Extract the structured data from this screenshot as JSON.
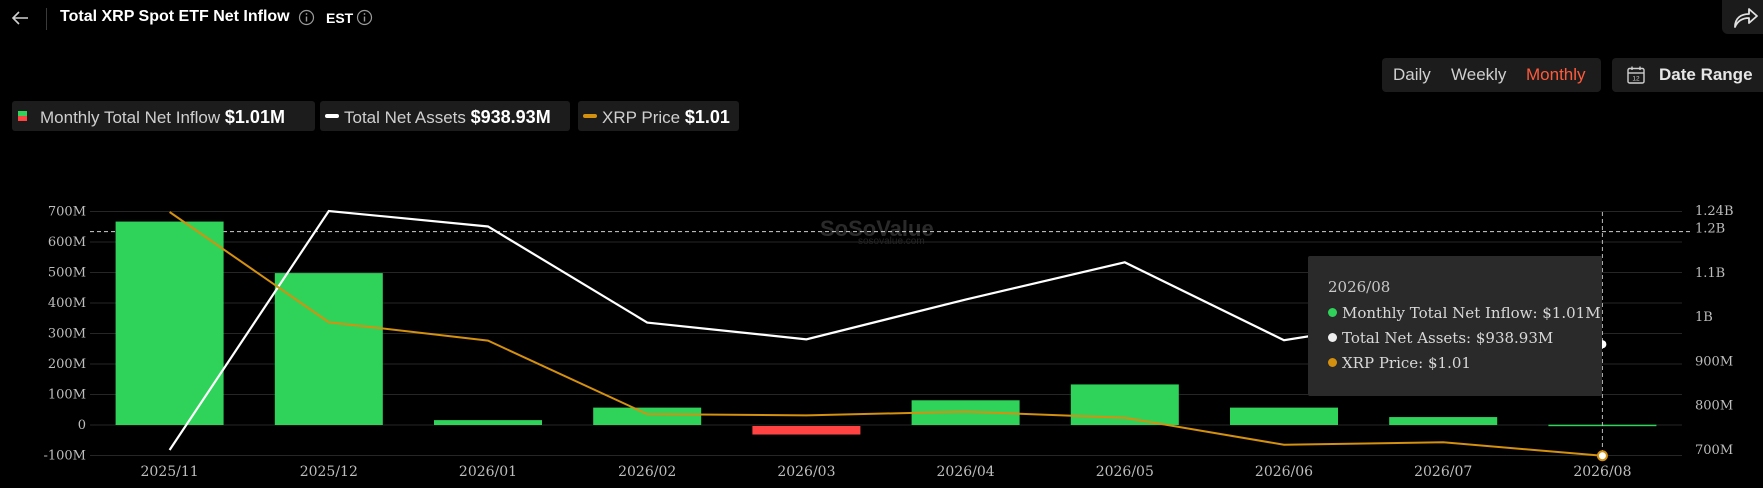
{
  "header": {
    "title": "Total XRP Spot ETF Net Inflow",
    "timezone": "EST"
  },
  "period_tabs": [
    {
      "label": "Daily",
      "active": false
    },
    {
      "label": "Weekly",
      "active": false
    },
    {
      "label": "Monthly",
      "active": true
    }
  ],
  "date_range_label": "Date Range",
  "legend": {
    "inflow_label": "Monthly Total Net Inflow",
    "inflow_value": "$1.01M",
    "assets_label": "Total Net Assets",
    "assets_value": "$938.93M",
    "price_label": "XRP Price",
    "price_value": "$1.01"
  },
  "watermark": {
    "name": "SoSoValue",
    "url": "sosovalue.com"
  },
  "tooltip": {
    "date": "2026/08",
    "inflow": "Monthly Total Net Inflow: $1.01M",
    "assets": "Total Net Assets: $938.93M",
    "price": "XRP Price: $1.01"
  },
  "colors": {
    "positive_bar": "#2fd35a",
    "negative_bar": "#ff4343",
    "assets_line": "#ffffff",
    "price_line": "#d4900f",
    "accent": "#ff5a3c"
  },
  "chart_data": {
    "type": "bar",
    "categories": [
      "2025/11",
      "2025/12",
      "2026/01",
      "2026/02",
      "2026/03",
      "2026/04",
      "2026/05",
      "2026/06",
      "2026/07",
      "2026/08"
    ],
    "y_left_ticks": [
      "700M",
      "600M",
      "500M",
      "400M",
      "300M",
      "200M",
      "100M",
      "0",
      "-100M"
    ],
    "y_right_ticks": [
      "1.24B",
      "1.2B",
      "1.1B",
      "1B",
      "900M",
      "800M",
      "700M"
    ],
    "left_axis_range": [
      -100,
      700
    ],
    "right_axis_range": [
      700,
      1240
    ],
    "series": [
      {
        "name": "Monthly Total Net Inflow",
        "axis": "left",
        "unit": "M",
        "values": [
          667,
          498,
          16,
          57,
          -28,
          81,
          133,
          57,
          26,
          1.01
        ]
      },
      {
        "name": "Total Net Assets",
        "axis": "right",
        "unit": "M",
        "values": [
          700,
          1240,
          1205,
          988,
          950,
          1040,
          1124,
          948,
          1005,
          938.93
        ]
      },
      {
        "name": "XRP Price",
        "axis": "hidden",
        "values": [
          3.0,
          2.1,
          1.95,
          1.35,
          1.34,
          1.37,
          1.32,
          1.1,
          1.12,
          1.01
        ]
      }
    ],
    "reference_line": {
      "axis": "left",
      "value": 634
    },
    "grid": true,
    "highlight_category": "2026/08"
  }
}
